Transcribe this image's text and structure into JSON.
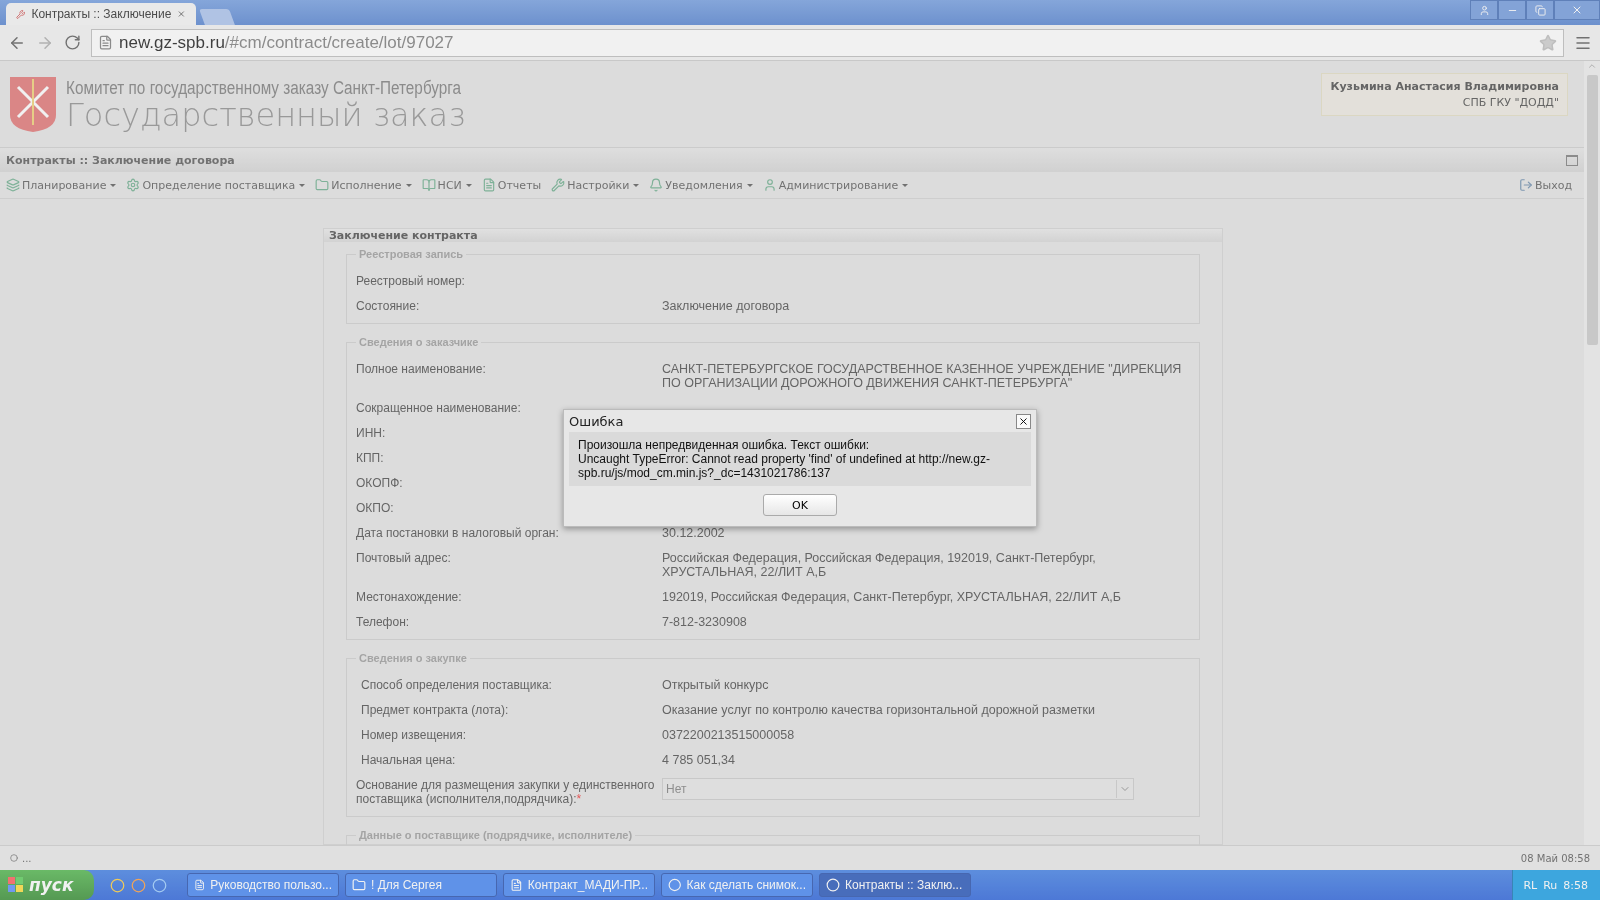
{
  "browser": {
    "tabs": [
      {
        "title": "Контракты :: Заключение",
        "selected": true
      }
    ],
    "url_host": "new.gz-spb.ru",
    "url_path": "/#cm/contract/create/lot/97027"
  },
  "header": {
    "org": "Комитет по государственному заказу Санкт-Петербурга",
    "title": "Государственный заказ",
    "user_name": "Кузьмина Анастасия Владимировна",
    "user_org": "СПБ ГКУ \"ДОДД\""
  },
  "page_title": "Контракты :: Заключение договора",
  "menu": [
    {
      "label": "Планирование",
      "dropdown": true
    },
    {
      "label": "Определение поставщика",
      "dropdown": true
    },
    {
      "label": "Исполнение",
      "dropdown": true
    },
    {
      "label": "НСИ",
      "dropdown": true
    },
    {
      "label": "Отчеты",
      "dropdown": false
    },
    {
      "label": "Настройки",
      "dropdown": true
    },
    {
      "label": "Уведомления",
      "dropdown": true
    },
    {
      "label": "Администрирование",
      "dropdown": true
    }
  ],
  "logout": "Выход",
  "panel": {
    "title": "Заключение контракта",
    "sections": [
      {
        "legend": "Реестровая запись",
        "rows": [
          {
            "kind": "text",
            "label": "Реестровый номер:"
          },
          {
            "kind": "text",
            "label": "Состояние:",
            "value": "Заключение договора"
          }
        ]
      },
      {
        "legend": "Сведения о заказчике",
        "rows": [
          {
            "kind": "text",
            "label": "Полное наименование:",
            "value": "САНКТ-ПЕТЕРБУРГСКОЕ ГОСУДАРСТВЕННОЕ КАЗЕННОЕ УЧРЕЖДЕНИЕ \"ДИРЕКЦИЯ ПО ОРГАНИЗАЦИИ ДОРОЖНОГО ДВИЖЕНИЯ САНКТ-ПЕТЕРБУРГА\""
          },
          {
            "kind": "text",
            "label": "Сокращенное наименование:"
          },
          {
            "kind": "text",
            "label": "ИНН:"
          },
          {
            "kind": "text",
            "label": "КПП:"
          },
          {
            "kind": "text",
            "label": "ОКОПФ:"
          },
          {
            "kind": "text",
            "label": "ОКПО:"
          },
          {
            "kind": "text",
            "label": "Дата постановки в налоговый орган:",
            "value": "30.12.2002"
          },
          {
            "kind": "text",
            "label": "Почтовый адрес:",
            "value": "Российская Федерация, Российская Федерация, 192019, Санкт-Петербург, ХРУСТАЛЬНАЯ, 22/ЛИТ А,Б"
          },
          {
            "kind": "text",
            "label": "Местонахождение:",
            "value": "192019, Российская Федерация, Санкт-Петербург, ХРУСТАЛЬНАЯ, 22/ЛИТ А,Б"
          },
          {
            "kind": "text",
            "label": "Телефон:",
            "value": "7-812-3230908"
          }
        ]
      },
      {
        "legend": "Сведения о закупке",
        "rows": [
          {
            "kind": "indented",
            "label": "Способ определения поставщика:",
            "value": "Открытый конкурс"
          },
          {
            "kind": "indented",
            "label": "Предмет контракта (лота):",
            "value": "Оказание услуг по контролю качества горизонтальной дорожной разметки"
          },
          {
            "kind": "indented",
            "label": "Номер извещения:",
            "value": "0372200213515000058"
          },
          {
            "kind": "indented",
            "label": "Начальная цена:",
            "value": "4 785 051,34"
          },
          {
            "kind": "select",
            "label": "Основание для размещения закупки у единственного поставщика (исполнителя,подрядчика):",
            "required_mark": "*",
            "value": "Нет",
            "disabled": true
          }
        ]
      },
      {
        "legend": "Данные о поставщике (подрядчике, исполнителе)"
      }
    ]
  },
  "dialog": {
    "title": "Ошибка",
    "message": "Произошла непредвиденная ошибка. Текст ошибки:",
    "detail": "Uncaught TypeError: Cannot read property 'find' of undefined at http://new.gz-spb.ru/js/mod_cm.min.js?_dc=1431021786:137",
    "button": "OK"
  },
  "status": {
    "left": "...",
    "right": "08 Май 08:58"
  },
  "taskbar": {
    "start": "пуск",
    "tasks": [
      {
        "label": "Руководство пользо...",
        "selected": false
      },
      {
        "label": "! Для Сергея",
        "selected": false
      },
      {
        "label": "Контракт_МАДИ-ПР...",
        "selected": false
      },
      {
        "label": "Как сделать снимок...",
        "selected": false
      },
      {
        "label": "Контракты :: Заклю...",
        "selected": true
      }
    ],
    "tray_left": "RL",
    "tray_lang": "Ru",
    "clock": "8:58"
  }
}
